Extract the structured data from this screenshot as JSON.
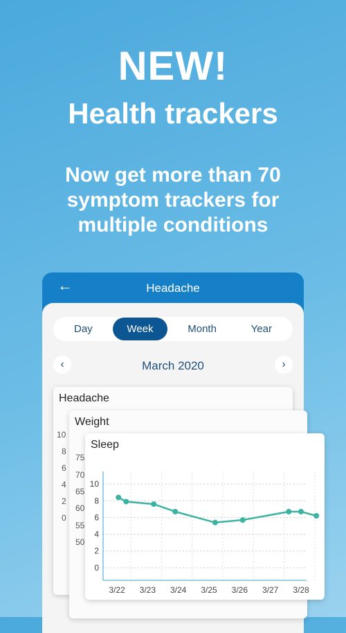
{
  "hero": {
    "headline": "NEW!",
    "subheadline": "Health trackers",
    "tagline_lines": [
      "Now get more than 70",
      "symptom trackers for",
      "multiple conditions"
    ]
  },
  "appbar": {
    "title": "Headache",
    "back_icon": "arrow-left-icon"
  },
  "segments": [
    {
      "label": "Day",
      "active": false
    },
    {
      "label": "Week",
      "active": true
    },
    {
      "label": "Month",
      "active": false
    },
    {
      "label": "Year",
      "active": false
    }
  ],
  "period": {
    "label": "March 2020",
    "prev_icon": "chevron-left-icon",
    "next_icon": "chevron-right-icon"
  },
  "cards": [
    {
      "title": "Headache",
      "y_ticks": [
        "10",
        "8",
        "6",
        "4",
        "2",
        "0"
      ]
    },
    {
      "title": "Weight",
      "y_ticks": [
        "75",
        "70",
        "65",
        "60",
        "55",
        "50"
      ]
    },
    {
      "title": "Sleep"
    }
  ],
  "colors": {
    "accent": "#1580c7",
    "line": "#3bb3a0"
  },
  "chart_data": {
    "type": "line",
    "title": "Sleep",
    "xlabel": "",
    "ylabel": "",
    "ylim": [
      -1.5,
      11.5
    ],
    "y_ticks": [
      0,
      2,
      4,
      6,
      8,
      10
    ],
    "x_ticks": [
      "3/22",
      "3/23",
      "3/24",
      "3/25",
      "3/26",
      "3/27",
      "3/28"
    ],
    "grid": true,
    "series": [
      {
        "name": "Sleep",
        "x": [
          0.05,
          0.3,
          1.2,
          1.9,
          3.2,
          4.1,
          5.6,
          6.0,
          6.5
        ],
        "values": [
          8.4,
          7.9,
          7.6,
          6.7,
          5.4,
          5.7,
          6.7,
          6.7,
          6.2
        ]
      }
    ]
  }
}
